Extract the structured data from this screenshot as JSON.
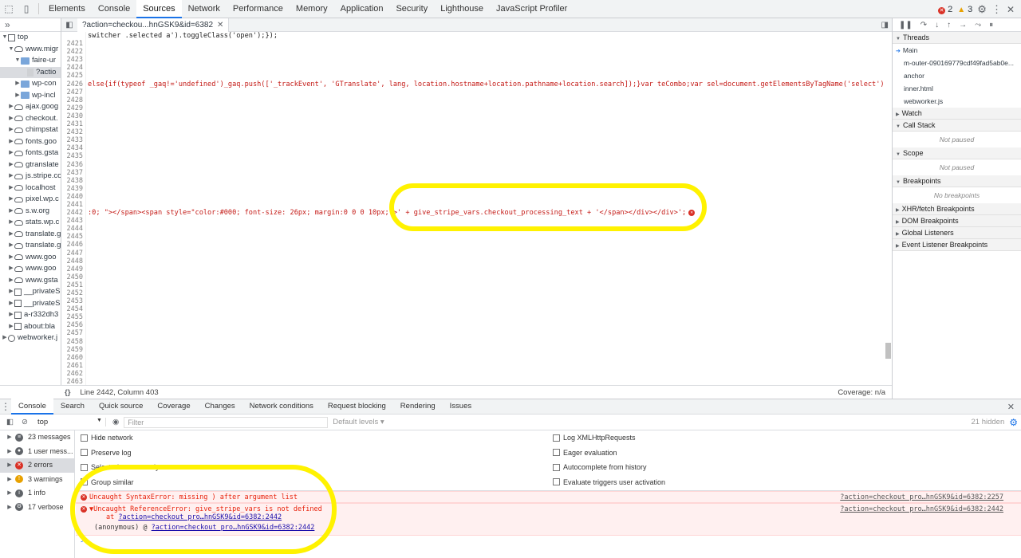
{
  "top_tabs": [
    "Elements",
    "Console",
    "Sources",
    "Network",
    "Performance",
    "Memory",
    "Application",
    "Security",
    "Lighthouse",
    "JavaScript Profiler"
  ],
  "active_top_tab": "Sources",
  "counters": {
    "errors": "2",
    "warnings": "3"
  },
  "navigator": {
    "items": [
      {
        "label": "top",
        "icon": "frame-icon",
        "indent": 0,
        "tw": "▼"
      },
      {
        "label": "www.migr",
        "icon": "cloud-icon",
        "indent": 1,
        "tw": "▼"
      },
      {
        "label": "faire-ur",
        "icon": "folder-icon",
        "indent": 2,
        "tw": "▼"
      },
      {
        "label": "?actio",
        "icon": "file-icon",
        "indent": 3,
        "tw": "",
        "selected": true
      },
      {
        "label": "wp-con",
        "icon": "folder-icon",
        "indent": 2,
        "tw": "▶"
      },
      {
        "label": "wp-incl",
        "icon": "folder-icon",
        "indent": 2,
        "tw": "▶"
      },
      {
        "label": "ajax.goog",
        "icon": "cloud-icon",
        "indent": 1,
        "tw": "▶"
      },
      {
        "label": "checkout.",
        "icon": "cloud-icon",
        "indent": 1,
        "tw": "▶"
      },
      {
        "label": "chimpstat",
        "icon": "cloud-icon",
        "indent": 1,
        "tw": "▶"
      },
      {
        "label": "fonts.goo",
        "icon": "cloud-icon",
        "indent": 1,
        "tw": "▶"
      },
      {
        "label": "fonts.gsta",
        "icon": "cloud-icon",
        "indent": 1,
        "tw": "▶"
      },
      {
        "label": "gtranslate",
        "icon": "cloud-icon",
        "indent": 1,
        "tw": "▶"
      },
      {
        "label": "js.stripe.co",
        "icon": "cloud-icon",
        "indent": 1,
        "tw": "▶"
      },
      {
        "label": "localhost",
        "icon": "cloud-icon",
        "indent": 1,
        "tw": "▶"
      },
      {
        "label": "pixel.wp.c",
        "icon": "cloud-icon",
        "indent": 1,
        "tw": "▶"
      },
      {
        "label": "s.w.org",
        "icon": "cloud-icon",
        "indent": 1,
        "tw": "▶"
      },
      {
        "label": "stats.wp.c",
        "icon": "cloud-icon",
        "indent": 1,
        "tw": "▶"
      },
      {
        "label": "translate.g",
        "icon": "cloud-icon",
        "indent": 1,
        "tw": "▶"
      },
      {
        "label": "translate.g",
        "icon": "cloud-icon",
        "indent": 1,
        "tw": "▶"
      },
      {
        "label": "www.goo",
        "icon": "cloud-icon",
        "indent": 1,
        "tw": "▶"
      },
      {
        "label": "www.goo",
        "icon": "cloud-icon",
        "indent": 1,
        "tw": "▶"
      },
      {
        "label": "www.gsta",
        "icon": "cloud-icon",
        "indent": 1,
        "tw": "▶"
      },
      {
        "label": "__privateS",
        "icon": "frame-icon",
        "indent": 1,
        "tw": "▶"
      },
      {
        "label": "__privateS",
        "icon": "frame-icon",
        "indent": 1,
        "tw": "▶"
      },
      {
        "label": "a-r332dh3",
        "icon": "frame-icon",
        "indent": 1,
        "tw": "▶"
      },
      {
        "label": "about:bla",
        "icon": "frame-icon",
        "indent": 1,
        "tw": "▶"
      },
      {
        "label": "webworker.j",
        "icon": "gear-icon",
        "indent": 0,
        "tw": "▶"
      }
    ]
  },
  "editor": {
    "tab_label": "?action=checkou...hnGSK9&id=6382",
    "first_line_fragment": "switcher .selected a').toggleClass('open');});",
    "line_2426": "else{if(typeof _gaq!='undefined')_gaq.push(['_trackEvent', 'GTranslate', lang, location.hostname+location.pathname+location.search]);}var teCombo;var sel=document.getElementsByTagName('select');for",
    "line_2442": ":0; \"></span><span style=\"color:#000; font-size: 26px; margin:0 0 0 10px;\">' + give_stripe_vars.checkout_processing_text + '</span></div></div>';",
    "line_numbers_start": 2421,
    "line_numbers_end": 2463
  },
  "status": {
    "position": "Line 2442, Column 403",
    "coverage": "Coverage: n/a"
  },
  "debugger": {
    "threads_label": "Threads",
    "threads": [
      "Main",
      "m-outer-090169779cdf49fad5ab0e...",
      "anchor",
      "inner.html",
      "webworker.js"
    ],
    "sections": [
      {
        "label": "Watch",
        "body": ""
      },
      {
        "label": "Call Stack",
        "body": "Not paused"
      },
      {
        "label": "Scope",
        "body": "Not paused"
      },
      {
        "label": "Breakpoints",
        "body": "No breakpoints"
      },
      {
        "label": "XHR/fetch Breakpoints",
        "body": ""
      },
      {
        "label": "DOM Breakpoints",
        "body": ""
      },
      {
        "label": "Global Listeners",
        "body": ""
      },
      {
        "label": "Event Listener Breakpoints",
        "body": ""
      }
    ]
  },
  "drawer_tabs": [
    "Console",
    "Search",
    "Quick source",
    "Coverage",
    "Changes",
    "Network conditions",
    "Request blocking",
    "Rendering",
    "Issues"
  ],
  "console_toolbar": {
    "context": "top",
    "filter_placeholder": "Filter",
    "levels": "Default levels ▾",
    "hidden": "21 hidden"
  },
  "console_sidebar": [
    {
      "label": "23 messages",
      "icon": "list-icon"
    },
    {
      "label": "1 user mess...",
      "icon": "user-icon"
    },
    {
      "label": "2 errors",
      "icon": "error-icon",
      "selected": true
    },
    {
      "label": "3 warnings",
      "icon": "warning-icon"
    },
    {
      "label": "1 info",
      "icon": "info-icon"
    },
    {
      "label": "17 verbose",
      "icon": "verbose-icon"
    }
  ],
  "console_settings": {
    "left": [
      "Hide network",
      "Preserve log",
      "Selected context only",
      "Group similar"
    ],
    "right": [
      "Log XMLHttpRequests",
      "Eager evaluation",
      "Autocomplete from history",
      "Evaluate triggers user activation"
    ]
  },
  "messages": [
    {
      "text": "Uncaught SyntaxError: missing ) after argument list",
      "source": "?action=checkout_pro…hnGSK9&id=6382:2257"
    },
    {
      "text": "▼Uncaught ReferenceError: give_stripe_vars is not defined",
      "at_prefix": "at ",
      "at_link": "?action=checkout_pro…hnGSK9&id=6382:2442",
      "anon_prefix": "(anonymous) @ ",
      "anon_link": "?action=checkout_pro…hnGSK9&id=6382:2442",
      "source": "?action=checkout_pro…hnGSK9&id=6382:2442"
    }
  ],
  "prompt_symbol": ">",
  "colors": {
    "accent": "#1a73e8",
    "error": "#d93025",
    "highlight": "#fff200"
  }
}
